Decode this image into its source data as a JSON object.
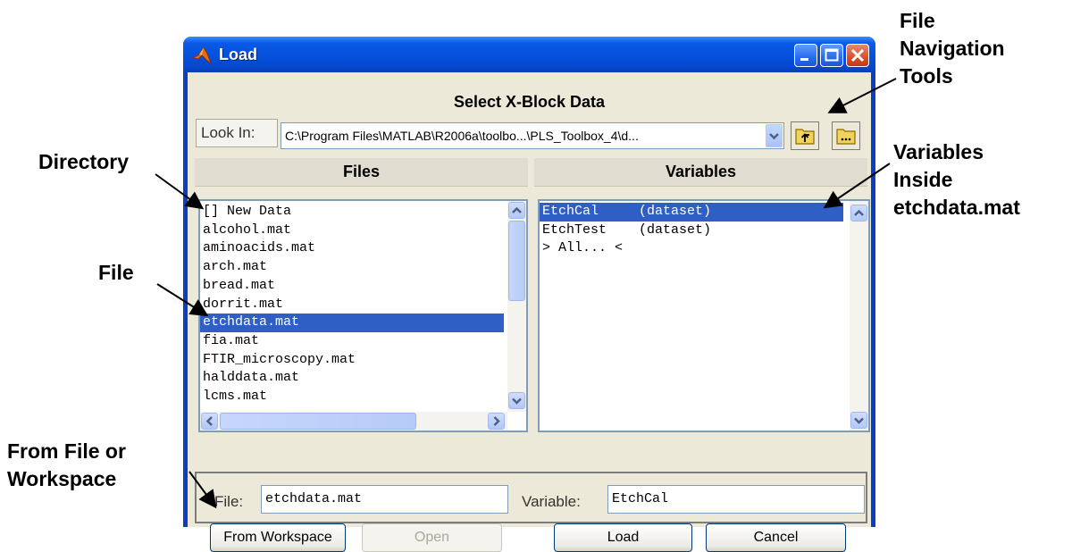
{
  "window": {
    "title": "Load",
    "header": "Select X-Block Data"
  },
  "look_in": {
    "label": "Look In:",
    "path": "C:\\Program Files\\MATLAB\\R2006a\\toolbo...\\PLS_Toolbox_4\\d..."
  },
  "files_panel": {
    "header": "Files",
    "items": [
      {
        "label": "[] New Data",
        "selected": false
      },
      {
        "label": "alcohol.mat",
        "selected": false
      },
      {
        "label": "aminoacids.mat",
        "selected": false
      },
      {
        "label": "arch.mat",
        "selected": false
      },
      {
        "label": "bread.mat",
        "selected": false
      },
      {
        "label": "dorrit.mat",
        "selected": false
      },
      {
        "label": "etchdata.mat",
        "selected": true
      },
      {
        "label": "fia.mat",
        "selected": false
      },
      {
        "label": "FTIR_microscopy.mat",
        "selected": false
      },
      {
        "label": "halddata.mat",
        "selected": false
      },
      {
        "label": "lcms.mat",
        "selected": false
      }
    ]
  },
  "variables_panel": {
    "header": "Variables",
    "items": [
      {
        "label": "EtchCal     (dataset)",
        "selected": true
      },
      {
        "label": "EtchTest    (dataset)",
        "selected": false
      },
      {
        "label": "> All... <",
        "selected": false
      }
    ]
  },
  "bottom": {
    "file_label": "File:",
    "file_value": "etchdata.mat",
    "variable_label": "Variable:",
    "variable_value": "EtchCal",
    "from_workspace": "From Workspace",
    "open": "Open",
    "load": "Load",
    "cancel": "Cancel"
  },
  "annotations": {
    "nav_tools": [
      "File",
      "Navigation",
      "Tools"
    ],
    "directory": "Directory",
    "file": "File",
    "variables_inside": [
      "Variables",
      "Inside",
      "etchdata.mat"
    ],
    "from_file": [
      "From File or",
      "Workspace"
    ]
  },
  "colors": {
    "title_bar": "#0550dd",
    "selection": "#2f5fc4",
    "client_bg": "#ece9d8"
  }
}
